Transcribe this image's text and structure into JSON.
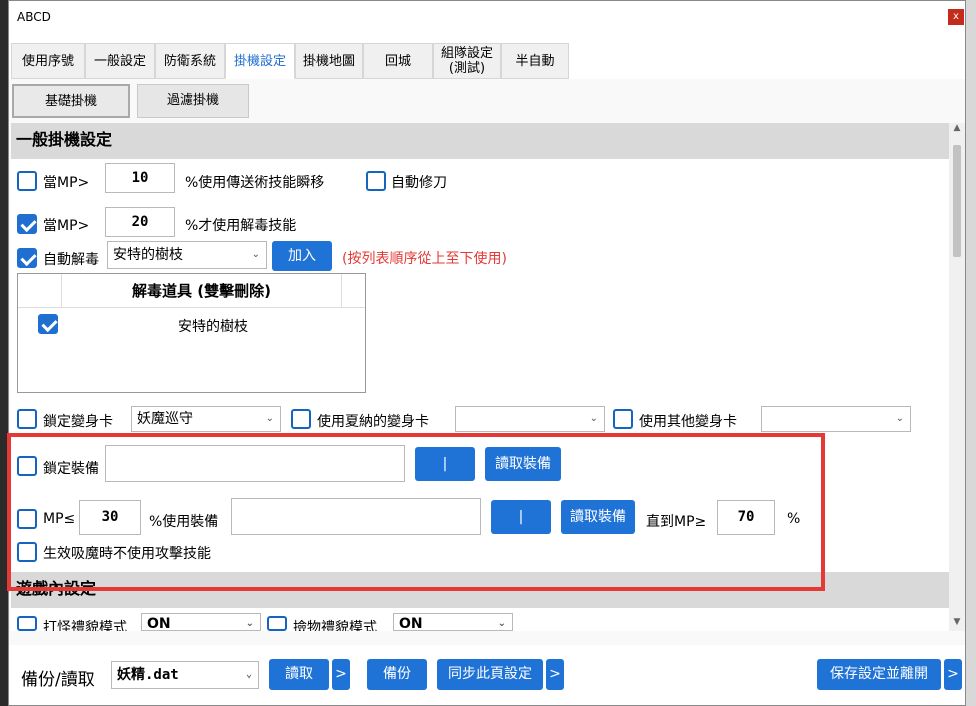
{
  "window": {
    "title": "ABCD",
    "close_label": "x"
  },
  "tabs": [
    {
      "label": "使用序號"
    },
    {
      "label": "一般設定"
    },
    {
      "label": "防衛系統"
    },
    {
      "label": "掛機設定",
      "active": true
    },
    {
      "label": "掛機地圖"
    },
    {
      "label": "回城"
    },
    {
      "label": "組隊設定\n(測試)"
    },
    {
      "label": "半自動"
    }
  ],
  "subtabs": [
    {
      "label": "基礎掛機",
      "active": true
    },
    {
      "label": "過濾掛機"
    }
  ],
  "general": {
    "section_title": "一般掛機設定",
    "mp_teleport": {
      "checked": false,
      "label": "當MP>",
      "value": "10",
      "suffix": "%使用傳送術技能瞬移"
    },
    "auto_repair": {
      "checked": false,
      "label": "自動修刀"
    },
    "mp_detox": {
      "checked": true,
      "label": "當MP>",
      "value": "20",
      "suffix": "%才使用解毒技能"
    },
    "auto_detox": {
      "checked": true,
      "label": "自動解毒",
      "selected": "安特的樹枝",
      "add_label": "加入",
      "note": "(按列表順序從上至下使用)"
    },
    "detox_table": {
      "header": "解毒道具 (雙擊刪除)",
      "rows": [
        {
          "checked": true,
          "item": "安特的樹枝"
        }
      ]
    },
    "lock_card": {
      "checked": false,
      "label": "鎖定變身卡",
      "selected": "妖魔巡守"
    },
    "nana_card": {
      "checked": false,
      "label": "使用夏納的變身卡",
      "selected": ""
    },
    "other_card": {
      "checked": false,
      "label": "使用其他變身卡",
      "selected": ""
    },
    "lock_equip": {
      "checked": false,
      "label": "鎖定裝備",
      "value": "",
      "sep_label": "|",
      "read_label": "讀取裝備"
    },
    "mp_equip": {
      "checked": false,
      "label": "MP≤",
      "value": "30",
      "suffix": "%使用裝備",
      "equip_value": "",
      "sep_label": "|",
      "read_label": "讀取裝備",
      "until_label": "直到MP≥",
      "until_value": "70",
      "percent": "%"
    },
    "no_attack_skill": {
      "checked": false,
      "label": "生效吸魔時不使用攻擊技能"
    }
  },
  "ingame": {
    "section_title": "遊戲內設定",
    "monster_mode": {
      "checked": false,
      "label": "打怪禮貌模式",
      "selected": "ON"
    },
    "pickup_mode": {
      "checked": false,
      "label": "撿物禮貌模式",
      "selected": "ON"
    }
  },
  "bottom": {
    "label": "備份/讀取",
    "file": "妖精.dat",
    "read_label": "讀取",
    "more1": ">",
    "backup_label": "備份",
    "sync_label": "同步此頁設定",
    "more2": ">",
    "save_label": "保存設定並離開",
    "more3": ">"
  },
  "colors": {
    "accent": "#1f73d6",
    "highlight_box": "#e53935",
    "note": "#e53935"
  }
}
